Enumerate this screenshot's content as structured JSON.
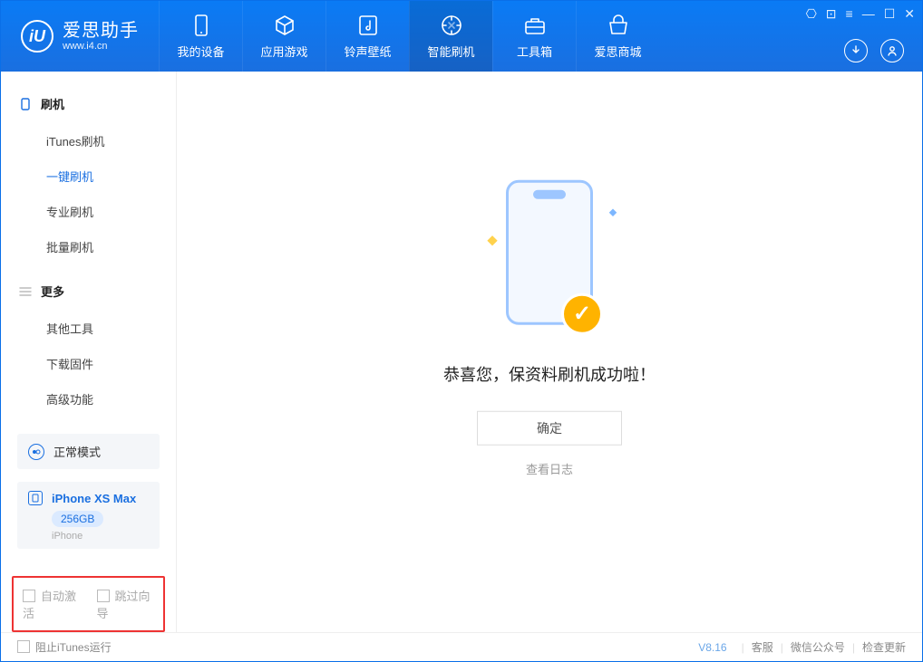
{
  "header": {
    "app_name_cn": "爱思助手",
    "app_url": "www.i4.cn",
    "nav": [
      {
        "label": "我的设备",
        "icon": "device"
      },
      {
        "label": "应用游戏",
        "icon": "apps"
      },
      {
        "label": "铃声壁纸",
        "icon": "music"
      },
      {
        "label": "智能刷机",
        "icon": "flash",
        "active": true
      },
      {
        "label": "工具箱",
        "icon": "toolbox"
      },
      {
        "label": "爱思商城",
        "icon": "store"
      }
    ]
  },
  "sidebar": {
    "groups": [
      {
        "title": "刷机",
        "icon": "phone",
        "items": [
          {
            "label": "iTunes刷机"
          },
          {
            "label": "一键刷机",
            "active": true
          },
          {
            "label": "专业刷机"
          },
          {
            "label": "批量刷机"
          }
        ]
      },
      {
        "title": "更多",
        "icon": "menu",
        "items": [
          {
            "label": "其他工具"
          },
          {
            "label": "下载固件"
          },
          {
            "label": "高级功能"
          }
        ]
      }
    ],
    "mode_label": "正常模式",
    "device": {
      "name": "iPhone XS Max",
      "capacity": "256GB",
      "type": "iPhone"
    },
    "highlight": {
      "auto_activate": "自动激活",
      "skip_guide": "跳过向导"
    }
  },
  "main": {
    "success_message": "恭喜您，保资料刷机成功啦！",
    "ok_button": "确定",
    "view_log": "查看日志"
  },
  "footer": {
    "block_itunes": "阻止iTunes运行",
    "version": "V8.16",
    "links": [
      "客服",
      "微信公众号",
      "检查更新"
    ]
  }
}
